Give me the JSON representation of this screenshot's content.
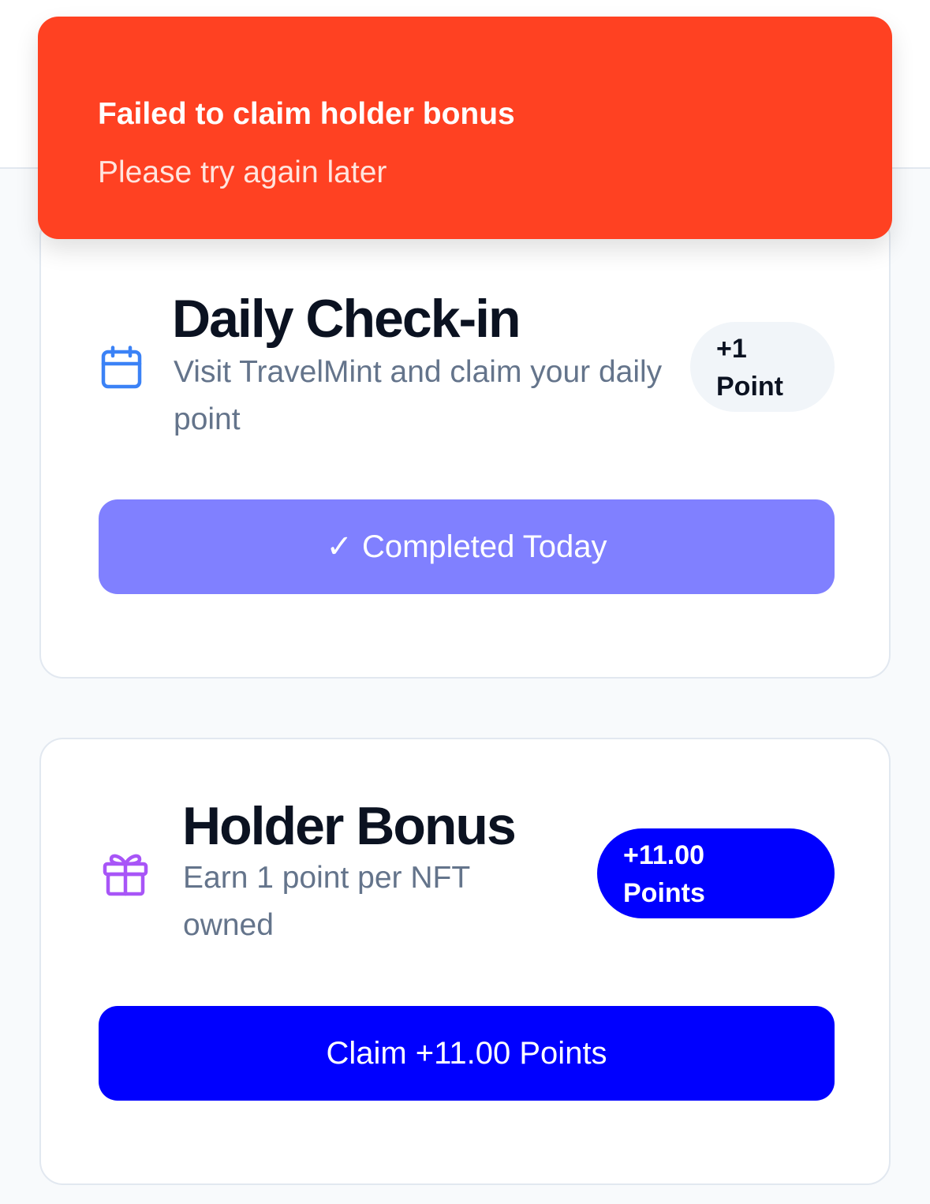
{
  "toast": {
    "title": "Failed to claim holder bonus",
    "message": "Please try again later",
    "color": "#ff4122"
  },
  "daily_checkin": {
    "icon": "calendar-icon",
    "icon_color": "#3b82f6",
    "title": "Daily Check-in",
    "description": "Visit TravelMint and claim your daily point",
    "badge_amount": "+1",
    "badge_unit": "Point",
    "button_check": "✓",
    "button_label": "Completed Today"
  },
  "holder_bonus": {
    "icon": "gift-icon",
    "icon_color": "#a855f7",
    "title": "Holder Bonus",
    "description": "Earn 1 point per NFT owned",
    "badge_amount": "+11.00",
    "badge_unit": "Points",
    "button_label": "Claim +11.00 Points"
  }
}
